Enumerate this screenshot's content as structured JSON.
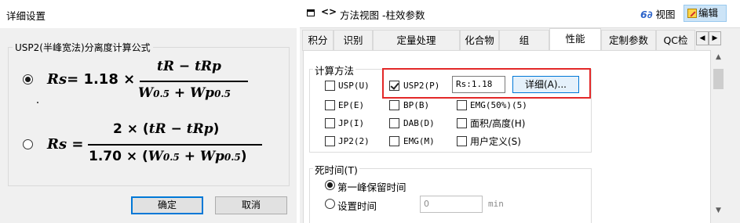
{
  "dialog": {
    "title": "详细设置",
    "group_label": "USP2(半峰宽法)分离度计算公式",
    "formula1": {
      "lhs": "Rs",
      "eq_coef": "= 1.18 ×",
      "num_a": "tR",
      "num_minus": "−",
      "num_b": "tRp",
      "den_a": "W",
      "den_a_sub": "0.5",
      "den_plus": "+",
      "den_b": "Wp",
      "den_b_sub": "0.5",
      "selected": true
    },
    "formula2": {
      "lhs": "Rs",
      "eq": "=",
      "num": "2 × (",
      "num_a": "tR",
      "num_minus": " − ",
      "num_b": "tRp",
      "num_close": ")",
      "den_pre": "1.70 × (",
      "den_a": "W",
      "den_a_sub": "0.5",
      "den_plus": " + ",
      "den_b": "Wp",
      "den_b_sub": "0.5",
      "den_close": ")",
      "selected": false
    },
    "ok_label": "确定",
    "cancel_label": "取消"
  },
  "panel": {
    "title": "方法视图 -柱效参数",
    "view_label": "视图",
    "edit_label": "编辑",
    "tabs": [
      "积分",
      "识别",
      "定量处理",
      "化合物",
      "组",
      "性能",
      "定制参数",
      "QC检"
    ],
    "active_tab": "性能",
    "calc": {
      "label": "计算方法",
      "options": [
        {
          "label": "USP(U)",
          "checked": false
        },
        {
          "label": "USP2(P)",
          "checked": true
        },
        {
          "label": "EP(E)",
          "checked": false
        },
        {
          "label": "BP(B)",
          "checked": false
        },
        {
          "label": "EMG(50%)(5)",
          "checked": false
        },
        {
          "label": "JP(I)",
          "checked": false
        },
        {
          "label": "DAB(D)",
          "checked": false
        },
        {
          "label": "面积/高度(H)",
          "checked": false
        },
        {
          "label": "JP2(2)",
          "checked": false
        },
        {
          "label": "EMG(M)",
          "checked": false
        },
        {
          "label": "用户定义(S)",
          "checked": false
        }
      ],
      "rs_value": "Rs:1.18",
      "detail_label": "详细(A)..."
    },
    "dead_time": {
      "label": "死时间(T)",
      "opt1": "第一峰保留时间",
      "opt2": "设置时间",
      "value": "0",
      "unit": "min",
      "selected": "第一峰保留时间"
    }
  },
  "colors": {
    "highlight": "#e32828",
    "accent": "#0078d7",
    "edit_active_bg": "#cce4f7"
  }
}
